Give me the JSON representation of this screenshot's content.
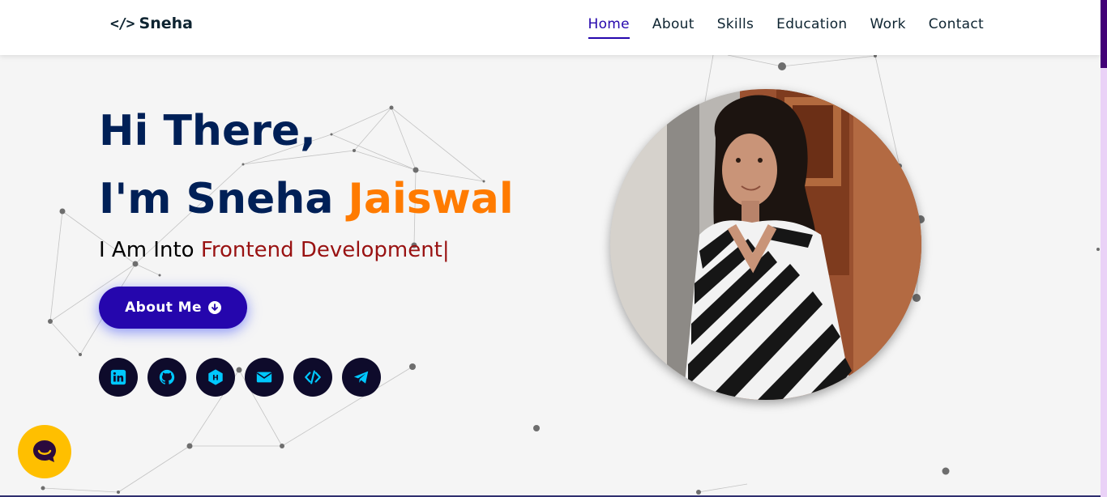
{
  "logo": {
    "icon": "code-icon",
    "glyph": "</>",
    "text": "Sneha"
  },
  "nav": [
    {
      "label": "Home",
      "active": true
    },
    {
      "label": "About",
      "active": false
    },
    {
      "label": "Skills",
      "active": false
    },
    {
      "label": "Education",
      "active": false
    },
    {
      "label": "Work",
      "active": false
    },
    {
      "label": "Contact",
      "active": false
    }
  ],
  "hero": {
    "greeting": "Hi There,",
    "intro": "I'm Sneha",
    "name_accent": "Jaiswal",
    "typed_prefix": "I Am Into",
    "typed_value": "Frontend Development|",
    "button_label": "About Me",
    "button_icon": "arrow-down-circle-icon"
  },
  "socials": [
    {
      "name": "linkedin-icon"
    },
    {
      "name": "github-icon"
    },
    {
      "name": "hashnode-icon"
    },
    {
      "name": "mail-icon"
    },
    {
      "name": "code-icon"
    },
    {
      "name": "telegram-icon"
    }
  ],
  "photo": {
    "description_icon": "profile-photo"
  },
  "chat": {
    "icon": "chat-bubble-icon"
  },
  "colors": {
    "brand": "#2506ad",
    "heading": "#002057",
    "accent_orange": "#ff7b00",
    "accent_red": "#991212",
    "social_bg": "#0e0b2b",
    "social_icon": "#00c8ff",
    "chat_bg": "#ffbf00",
    "scroll_thumb": "#420177"
  }
}
